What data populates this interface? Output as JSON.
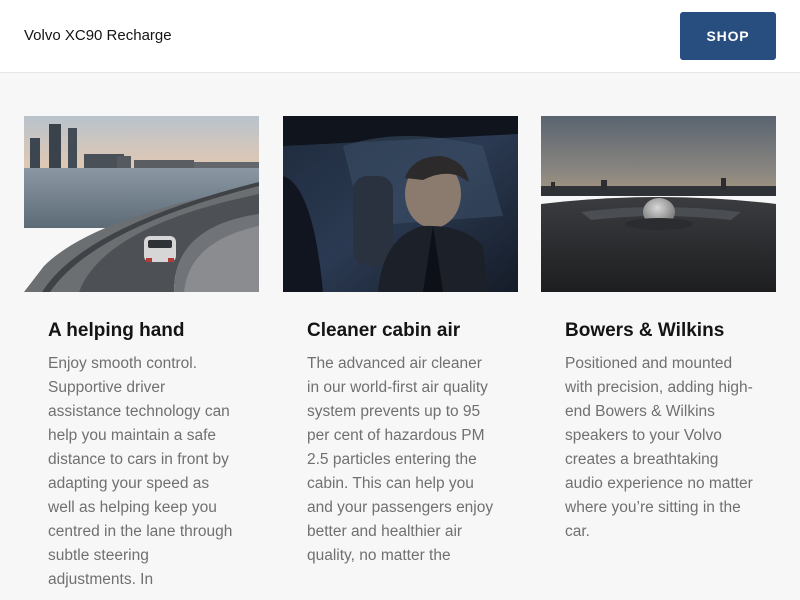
{
  "header": {
    "model_name": "Volvo XC90 Recharge",
    "shop_label": "SHOP",
    "shop_color": "#284e80"
  },
  "cards": [
    {
      "image": "car-on-curved-highway-city-skyline",
      "title": "A helping hand",
      "text": "Enjoy smooth control. Supportive driver assistance technology can help you maintain a safe distance to cars in front by adapting your speed as well as helping keep you centred in the lane through subtle steering adjustments. In"
    },
    {
      "image": "driver-in-car-cabin",
      "title": "Cleaner cabin air",
      "text": "The advanced air cleaner in our world-first air quality system prevents up to 95 per cent of hazardous PM 2.5 particles entering the cabin. This can help you and your passengers enjoy better and healthier air quality, no matter the"
    },
    {
      "image": "dashboard-speaker-closeup",
      "title": "Bowers & Wilkins",
      "text": "Positioned and mounted with precision, adding high-end Bowers & Wilkins speakers to your Volvo creates a breathtaking audio experience no matter where you’re sitting in the car."
    }
  ]
}
